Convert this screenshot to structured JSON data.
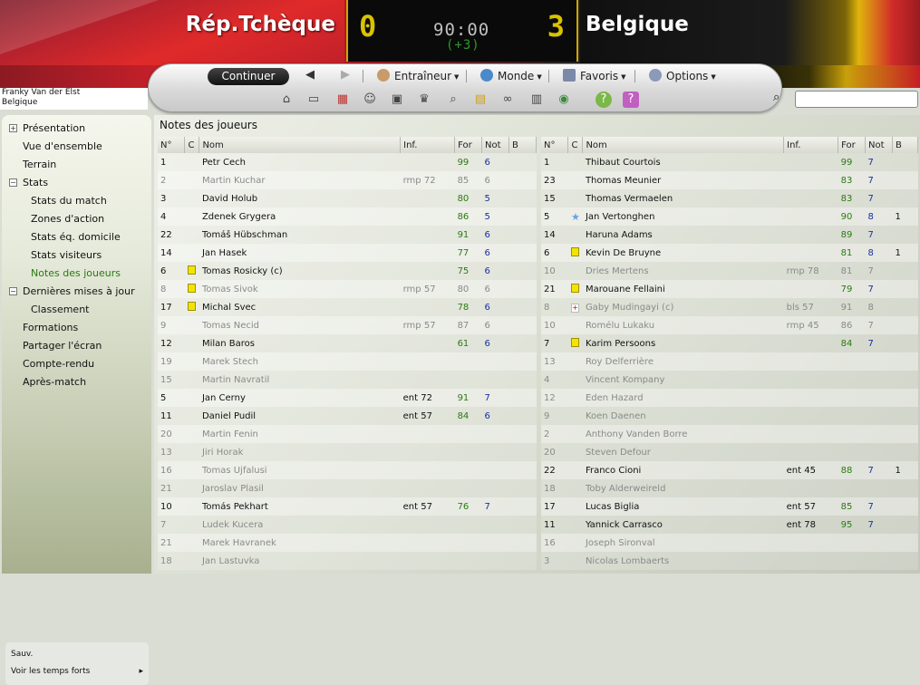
{
  "match": {
    "home_team": "Rép.Tchèque",
    "away_team": "Belgique",
    "home_score": "0",
    "away_score": "3",
    "clock": "90:00",
    "added_time": "(+3)"
  },
  "nav": {
    "continue_label": "Continuer",
    "back_arrow": "◀",
    "forward_arrow": "▶",
    "menus": [
      "Entraîneur",
      "Monde",
      "Favoris",
      "Options"
    ]
  },
  "manager": {
    "name": "Franky Van der Elst",
    "team": "Belgique"
  },
  "toolbar_icons": [
    "home-icon",
    "club-icon",
    "calendar-icon",
    "squad-icon",
    "tactics-icon",
    "trophy-icon",
    "scout-icon",
    "notes-icon",
    "binoculars-icon",
    "news-icon",
    "globe-icon",
    "help-icon",
    "question-icon"
  ],
  "sidebar": {
    "items": [
      {
        "label": "Présentation",
        "level": 0,
        "expander": "+"
      },
      {
        "label": "Vue d'ensemble",
        "level": 0,
        "expander": ""
      },
      {
        "label": "Terrain",
        "level": 0,
        "expander": ""
      },
      {
        "label": "Stats",
        "level": 0,
        "expander": "−"
      },
      {
        "label": "Stats du match",
        "level": 1,
        "expander": ""
      },
      {
        "label": "Zones d'action",
        "level": 1,
        "expander": ""
      },
      {
        "label": "Stats éq. domicile",
        "level": 1,
        "expander": ""
      },
      {
        "label": "Stats visiteurs",
        "level": 1,
        "expander": ""
      },
      {
        "label": "Notes des joueurs",
        "level": 1,
        "expander": "",
        "active": true
      },
      {
        "label": "Dernières mises à jour",
        "level": 0,
        "expander": "−"
      },
      {
        "label": "Classement",
        "level": 1,
        "expander": ""
      },
      {
        "label": "Formations",
        "level": 0,
        "expander": ""
      },
      {
        "label": "Partager l'écran",
        "level": 0,
        "expander": ""
      },
      {
        "label": "Compte-rendu",
        "level": 0,
        "expander": ""
      },
      {
        "label": "Après-match",
        "level": 0,
        "expander": ""
      }
    ],
    "save_label": "Sauv.",
    "highlights_label": "Voir les temps forts",
    "highlights_caret": "▸"
  },
  "page_title": "Notes des joueurs",
  "table_headers": [
    "N°",
    "C",
    "Nom",
    "Inf.",
    "For",
    "Not",
    "B"
  ],
  "home_players": [
    {
      "num": "1",
      "card": "",
      "name": "Petr Cech",
      "inf": "",
      "for": "99",
      "not": "6",
      "b": "",
      "sub": false
    },
    {
      "num": "2",
      "card": "",
      "name": "Martin Kuchar",
      "inf": "rmp 72",
      "for": "85",
      "not": "6",
      "b": "",
      "sub": true
    },
    {
      "num": "3",
      "card": "",
      "name": "David Holub",
      "inf": "",
      "for": "80",
      "not": "5",
      "b": "",
      "sub": false
    },
    {
      "num": "4",
      "card": "",
      "name": "Zdenek Grygera",
      "inf": "",
      "for": "86",
      "not": "5",
      "b": "",
      "sub": false
    },
    {
      "num": "22",
      "card": "",
      "name": "Tomáš Hübschman",
      "inf": "",
      "for": "91",
      "not": "6",
      "b": "",
      "sub": false
    },
    {
      "num": "14",
      "card": "",
      "name": "Jan Hasek",
      "inf": "",
      "for": "77",
      "not": "6",
      "b": "",
      "sub": false
    },
    {
      "num": "6",
      "card": "yellow",
      "name": "Tomas Rosicky (c)",
      "inf": "",
      "for": "75",
      "not": "6",
      "b": "",
      "sub": false
    },
    {
      "num": "8",
      "card": "yellow",
      "name": "Tomas Sivok",
      "inf": "rmp 57",
      "for": "80",
      "not": "6",
      "b": "",
      "sub": true
    },
    {
      "num": "17",
      "card": "yellow",
      "name": "Michal Svec",
      "inf": "",
      "for": "78",
      "not": "6",
      "b": "",
      "sub": false
    },
    {
      "num": "9",
      "card": "",
      "name": "Tomas Necid",
      "inf": "rmp 57",
      "for": "87",
      "not": "6",
      "b": "",
      "sub": true
    },
    {
      "num": "12",
      "card": "",
      "name": "Milan Baros",
      "inf": "",
      "for": "61",
      "not": "6",
      "b": "",
      "sub": false
    },
    {
      "num": "19",
      "card": "",
      "name": "Marek Stech",
      "inf": "",
      "for": "",
      "not": "",
      "b": "",
      "sub": true
    },
    {
      "num": "15",
      "card": "",
      "name": "Martin Navratil",
      "inf": "",
      "for": "",
      "not": "",
      "b": "",
      "sub": true
    },
    {
      "num": "5",
      "card": "",
      "name": "Jan Cerny",
      "inf": "ent 72",
      "for": "91",
      "not": "7",
      "b": "",
      "sub": false
    },
    {
      "num": "11",
      "card": "",
      "name": "Daniel Pudil",
      "inf": "ent 57",
      "for": "84",
      "not": "6",
      "b": "",
      "sub": false
    },
    {
      "num": "20",
      "card": "",
      "name": "Martin Fenin",
      "inf": "",
      "for": "",
      "not": "",
      "b": "",
      "sub": true
    },
    {
      "num": "13",
      "card": "",
      "name": "Jiri Horak",
      "inf": "",
      "for": "",
      "not": "",
      "b": "",
      "sub": true
    },
    {
      "num": "16",
      "card": "",
      "name": "Tomas Ujfalusi",
      "inf": "",
      "for": "",
      "not": "",
      "b": "",
      "sub": true
    },
    {
      "num": "21",
      "card": "",
      "name": "Jaroslav Plasil",
      "inf": "",
      "for": "",
      "not": "",
      "b": "",
      "sub": true
    },
    {
      "num": "10",
      "card": "",
      "name": "Tomás Pekhart",
      "inf": "ent 57",
      "for": "76",
      "not": "7",
      "b": "",
      "sub": false
    },
    {
      "num": "7",
      "card": "",
      "name": "Ludek Kucera",
      "inf": "",
      "for": "",
      "not": "",
      "b": "",
      "sub": true
    },
    {
      "num": "21",
      "card": "",
      "name": "Marek Havranek",
      "inf": "",
      "for": "",
      "not": "",
      "b": "",
      "sub": true
    },
    {
      "num": "18",
      "card": "",
      "name": "Jan Lastuvka",
      "inf": "",
      "for": "",
      "not": "",
      "b": "",
      "sub": true
    }
  ],
  "away_players": [
    {
      "num": "1",
      "card": "",
      "name": "Thibaut Courtois",
      "inf": "",
      "for": "99",
      "not": "7",
      "b": "",
      "sub": false
    },
    {
      "num": "23",
      "card": "",
      "name": "Thomas Meunier",
      "inf": "",
      "for": "83",
      "not": "7",
      "b": "",
      "sub": false
    },
    {
      "num": "15",
      "card": "",
      "name": "Thomas Vermaelen",
      "inf": "",
      "for": "83",
      "not": "7",
      "b": "",
      "sub": false
    },
    {
      "num": "5",
      "card": "star",
      "name": "Jan Vertonghen",
      "inf": "",
      "for": "90",
      "not": "8",
      "b": "1",
      "sub": false
    },
    {
      "num": "14",
      "card": "",
      "name": "Haruna Adams",
      "inf": "",
      "for": "89",
      "not": "7",
      "b": "",
      "sub": false
    },
    {
      "num": "6",
      "card": "yellow",
      "name": "Kevin De Bruyne",
      "inf": "",
      "for": "81",
      "not": "8",
      "b": "1",
      "sub": false
    },
    {
      "num": "10",
      "card": "",
      "name": "Dries Mertens",
      "inf": "rmp 78",
      "for": "81",
      "not": "7",
      "b": "",
      "sub": true
    },
    {
      "num": "21",
      "card": "yellow",
      "name": "Marouane Fellaini",
      "inf": "",
      "for": "79",
      "not": "7",
      "b": "",
      "sub": false
    },
    {
      "num": "8",
      "card": "injury",
      "name": "Gaby Mudingayi (c)",
      "inf": "bls 57",
      "for": "91",
      "not": "8",
      "b": "",
      "sub": true
    },
    {
      "num": "10",
      "card": "",
      "name": "Romélu Lukaku",
      "inf": "rmp 45",
      "for": "86",
      "not": "7",
      "b": "",
      "sub": true
    },
    {
      "num": "7",
      "card": "yellow",
      "name": "Karim Persoons",
      "inf": "",
      "for": "84",
      "not": "7",
      "b": "",
      "sub": false
    },
    {
      "num": "13",
      "card": "",
      "name": "Roy Delferrière",
      "inf": "",
      "for": "",
      "not": "",
      "b": "",
      "sub": true
    },
    {
      "num": "4",
      "card": "",
      "name": "Vincent Kompany",
      "inf": "",
      "for": "",
      "not": "",
      "b": "",
      "sub": true
    },
    {
      "num": "12",
      "card": "",
      "name": "Eden Hazard",
      "inf": "",
      "for": "",
      "not": "",
      "b": "",
      "sub": true
    },
    {
      "num": "9",
      "card": "",
      "name": "Koen Daenen",
      "inf": "",
      "for": "",
      "not": "",
      "b": "",
      "sub": true
    },
    {
      "num": "2",
      "card": "",
      "name": "Anthony Vanden Borre",
      "inf": "",
      "for": "",
      "not": "",
      "b": "",
      "sub": true
    },
    {
      "num": "20",
      "card": "",
      "name": "Steven Defour",
      "inf": "",
      "for": "",
      "not": "",
      "b": "",
      "sub": true
    },
    {
      "num": "22",
      "card": "",
      "name": "Franco Cioni",
      "inf": "ent 45",
      "for": "88",
      "not": "7",
      "b": "1",
      "sub": false
    },
    {
      "num": "18",
      "card": "",
      "name": "Toby Alderweireld",
      "inf": "",
      "for": "",
      "not": "",
      "b": "",
      "sub": true
    },
    {
      "num": "17",
      "card": "",
      "name": "Lucas Biglia",
      "inf": "ent 57",
      "for": "85",
      "not": "7",
      "b": "",
      "sub": false
    },
    {
      "num": "11",
      "card": "",
      "name": "Yannick Carrasco",
      "inf": "ent 78",
      "for": "95",
      "not": "7",
      "b": "",
      "sub": false
    },
    {
      "num": "16",
      "card": "",
      "name": "Joseph Sironval",
      "inf": "",
      "for": "",
      "not": "",
      "b": "",
      "sub": true
    },
    {
      "num": "3",
      "card": "",
      "name": "Nicolas Lombaerts",
      "inf": "",
      "for": "",
      "not": "",
      "b": "",
      "sub": true
    }
  ]
}
